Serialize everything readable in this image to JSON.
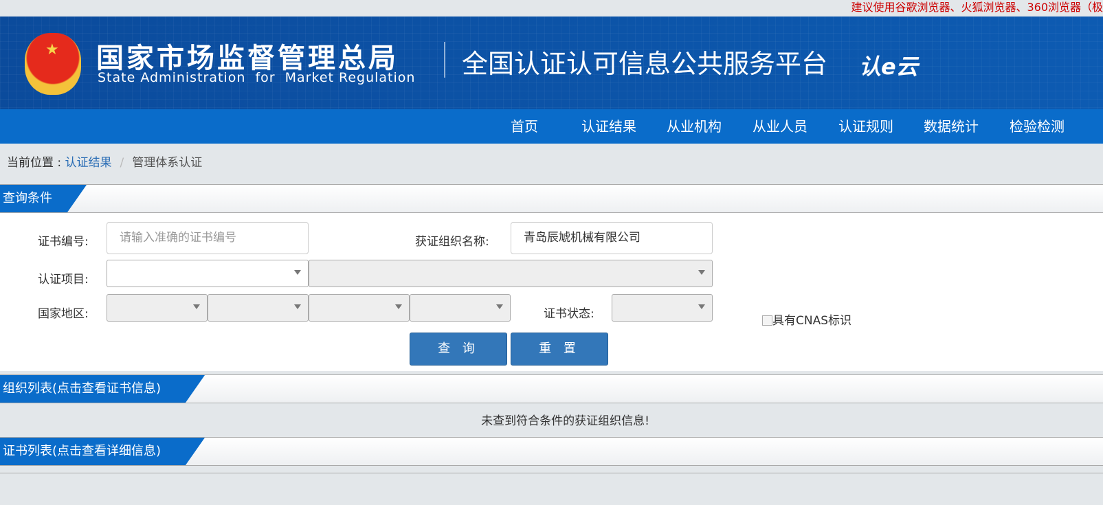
{
  "browser_tip": "建议使用谷歌浏览器、火狐浏览器、360浏览器（极",
  "header": {
    "org_cn": "国家市场监督管理总局",
    "org_en": "State Administration  for  Market Regulation",
    "platform": "全国认证认可信息公共服务平台",
    "logo_text": "认e云"
  },
  "nav": [
    "首页",
    "认证结果",
    "从业机构",
    "从业人员",
    "认证规则",
    "数据统计",
    "检验检测"
  ],
  "breadcrumb": {
    "prefix": "当前位置 : ",
    "link": "认证结果",
    "sep": "/",
    "current": "管理体系认证"
  },
  "query": {
    "title": "查询条件",
    "cert_no_label": "证书编号:",
    "cert_no_placeholder": "请输入准确的证书编号",
    "cert_no_value": "",
    "org_label": "获证组织名称:",
    "org_value": "青岛辰虓机械有限公司",
    "project_label": "认证项目:",
    "region_label": "国家地区:",
    "status_label": "证书状态:",
    "cnas_label": "具有CNAS标识",
    "cnas_checked": false,
    "search_button": "查 询",
    "reset_button": "重 置"
  },
  "org_list": {
    "title": "组织列表(点击查看证书信息)",
    "empty_message": "未查到符合条件的获证组织信息!"
  },
  "cert_list": {
    "title": "证书列表(点击查看详细信息)"
  },
  "colors": {
    "header": "#0b4fa3",
    "nav": "#0a6cca",
    "button": "#3377b9",
    "tip": "#cc0000"
  }
}
